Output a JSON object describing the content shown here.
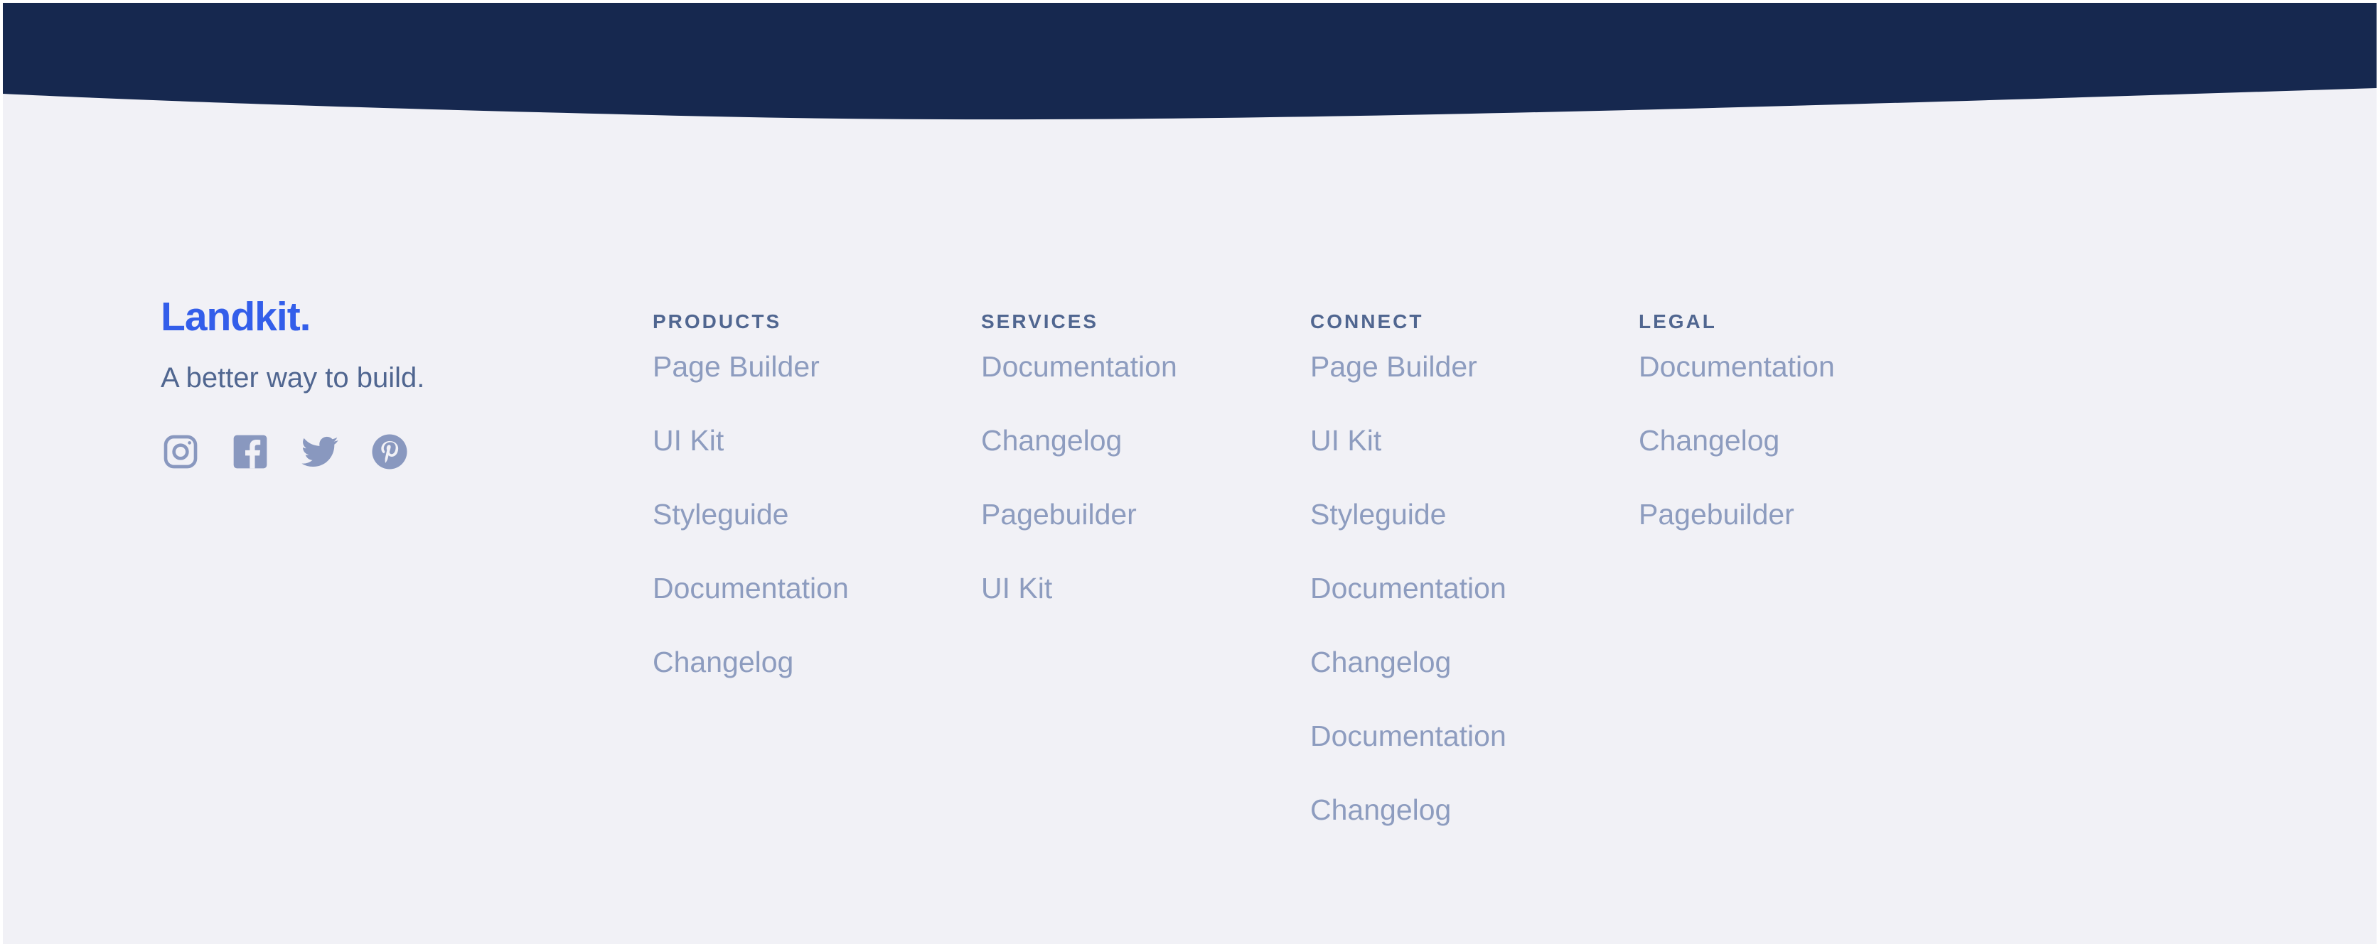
{
  "colors": {
    "page_background": "#f1f1f6",
    "header_band": "#16284f",
    "brand": "#335eea",
    "heading_text": "#506690",
    "link_text": "#8d9cbf",
    "icon": "#8998bf"
  },
  "brand": {
    "name": "Landkit.",
    "tagline": "A better way to build."
  },
  "social": [
    {
      "name": "Instagram",
      "icon": "instagram-icon"
    },
    {
      "name": "Facebook",
      "icon": "facebook-icon"
    },
    {
      "name": "Twitter",
      "icon": "twitter-icon"
    },
    {
      "name": "Pinterest",
      "icon": "pinterest-icon"
    }
  ],
  "columns": [
    {
      "heading": "PRODUCTS",
      "links": [
        "Page Builder",
        "UI Kit",
        "Styleguide",
        "Documentation",
        "Changelog"
      ]
    },
    {
      "heading": "SERVICES",
      "links": [
        "Documentation",
        "Changelog",
        "Pagebuilder",
        "UI Kit"
      ]
    },
    {
      "heading": "CONNECT",
      "links": [
        "Page Builder",
        "UI Kit",
        "Styleguide",
        "Documentation",
        "Changelog",
        "Documentation",
        "Changelog"
      ]
    },
    {
      "heading": "LEGAL",
      "links": [
        "Documentation",
        "Changelog",
        "Pagebuilder"
      ]
    }
  ]
}
